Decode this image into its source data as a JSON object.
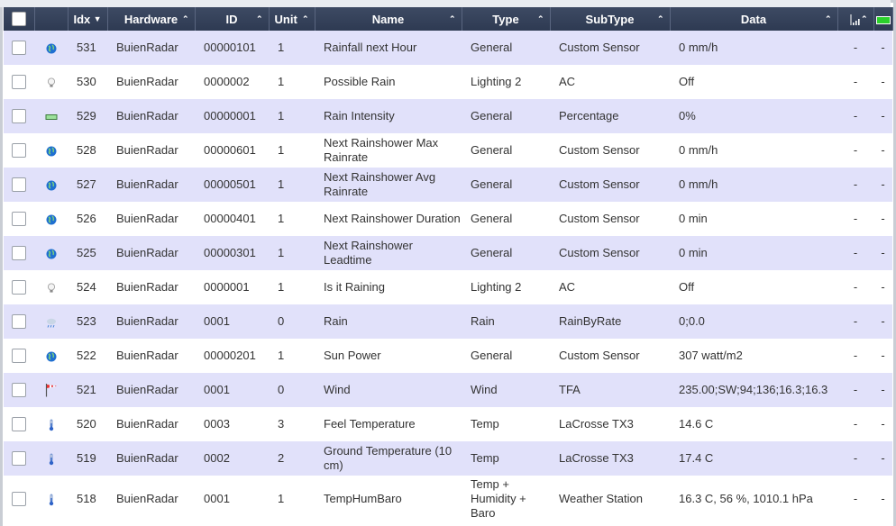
{
  "header": {
    "idx": "Idx",
    "hardware": "Hardware",
    "id": "ID",
    "unit": "Unit",
    "name": "Name",
    "type": "Type",
    "subtype": "SubType",
    "data": "Data"
  },
  "colors": {
    "header_bg": "#2e3a52",
    "row_odd": "#e1e1fa",
    "row_even": "#ffffff",
    "battery": "#2bd12b"
  },
  "rows": [
    {
      "icon": "globe-icon",
      "idx": "531",
      "hardware": "BuienRadar",
      "id": "00000101",
      "unit": "1",
      "name": "Rainfall next Hour",
      "type": "General",
      "subtype": "Custom Sensor",
      "data": "0 mm/h",
      "signal": "-",
      "battery": "-"
    },
    {
      "icon": "lightbulb-icon",
      "idx": "530",
      "hardware": "BuienRadar",
      "id": "0000002",
      "unit": "1",
      "name": "Possible Rain",
      "type": "Lighting 2",
      "subtype": "AC",
      "data": "Off",
      "signal": "-",
      "battery": "-"
    },
    {
      "icon": "percentage-icon",
      "idx": "529",
      "hardware": "BuienRadar",
      "id": "00000001",
      "unit": "1",
      "name": "Rain Intensity",
      "type": "General",
      "subtype": "Percentage",
      "data": "0%",
      "signal": "-",
      "battery": "-"
    },
    {
      "icon": "globe-icon",
      "idx": "528",
      "hardware": "BuienRadar",
      "id": "00000601",
      "unit": "1",
      "name": "Next Rainshower Max Rainrate",
      "type": "General",
      "subtype": "Custom Sensor",
      "data": "0 mm/h",
      "signal": "-",
      "battery": "-"
    },
    {
      "icon": "globe-icon",
      "idx": "527",
      "hardware": "BuienRadar",
      "id": "00000501",
      "unit": "1",
      "name": "Next Rainshower Avg Rainrate",
      "type": "General",
      "subtype": "Custom Sensor",
      "data": "0 mm/h",
      "signal": "-",
      "battery": "-"
    },
    {
      "icon": "globe-icon",
      "idx": "526",
      "hardware": "BuienRadar",
      "id": "00000401",
      "unit": "1",
      "name": "Next Rainshower Duration",
      "type": "General",
      "subtype": "Custom Sensor",
      "data": "0 min",
      "signal": "-",
      "battery": "-"
    },
    {
      "icon": "globe-icon",
      "idx": "525",
      "hardware": "BuienRadar",
      "id": "00000301",
      "unit": "1",
      "name": "Next Rainshower Leadtime",
      "type": "General",
      "subtype": "Custom Sensor",
      "data": "0 min",
      "signal": "-",
      "battery": "-"
    },
    {
      "icon": "lightbulb-icon",
      "idx": "524",
      "hardware": "BuienRadar",
      "id": "0000001",
      "unit": "1",
      "name": "Is it Raining",
      "type": "Lighting 2",
      "subtype": "AC",
      "data": "Off",
      "signal": "-",
      "battery": "-"
    },
    {
      "icon": "rain-cloud-icon",
      "idx": "523",
      "hardware": "BuienRadar",
      "id": "0001",
      "unit": "0",
      "name": "Rain",
      "type": "Rain",
      "subtype": "RainByRate",
      "data": "0;0.0",
      "signal": "-",
      "battery": "-"
    },
    {
      "icon": "globe-icon",
      "idx": "522",
      "hardware": "BuienRadar",
      "id": "00000201",
      "unit": "1",
      "name": "Sun Power",
      "type": "General",
      "subtype": "Custom Sensor",
      "data": "307 watt/m2",
      "signal": "-",
      "battery": "-"
    },
    {
      "icon": "wind-flag-icon",
      "idx": "521",
      "hardware": "BuienRadar",
      "id": "0001",
      "unit": "0",
      "name": "Wind",
      "type": "Wind",
      "subtype": "TFA",
      "data": "235.00;SW;94;136;16.3;16.3",
      "signal": "-",
      "battery": "-"
    },
    {
      "icon": "thermometer-icon",
      "idx": "520",
      "hardware": "BuienRadar",
      "id": "0003",
      "unit": "3",
      "name": "Feel Temperature",
      "type": "Temp",
      "subtype": "LaCrosse TX3",
      "data": "14.6 C",
      "signal": "-",
      "battery": "-"
    },
    {
      "icon": "thermometer-icon",
      "idx": "519",
      "hardware": "BuienRadar",
      "id": "0002",
      "unit": "2",
      "name": "Ground Temperature (10 cm)",
      "type": "Temp",
      "subtype": "LaCrosse TX3",
      "data": "17.4 C",
      "signal": "-",
      "battery": "-"
    },
    {
      "icon": "thermometer-icon",
      "idx": "518",
      "hardware": "BuienRadar",
      "id": "0001",
      "unit": "1",
      "name": "TempHumBaro",
      "type": "Temp + Humidity + Baro",
      "subtype": "Weather Station",
      "data": "16.3 C, 56 %, 1010.1 hPa",
      "signal": "-",
      "battery": "-"
    }
  ]
}
